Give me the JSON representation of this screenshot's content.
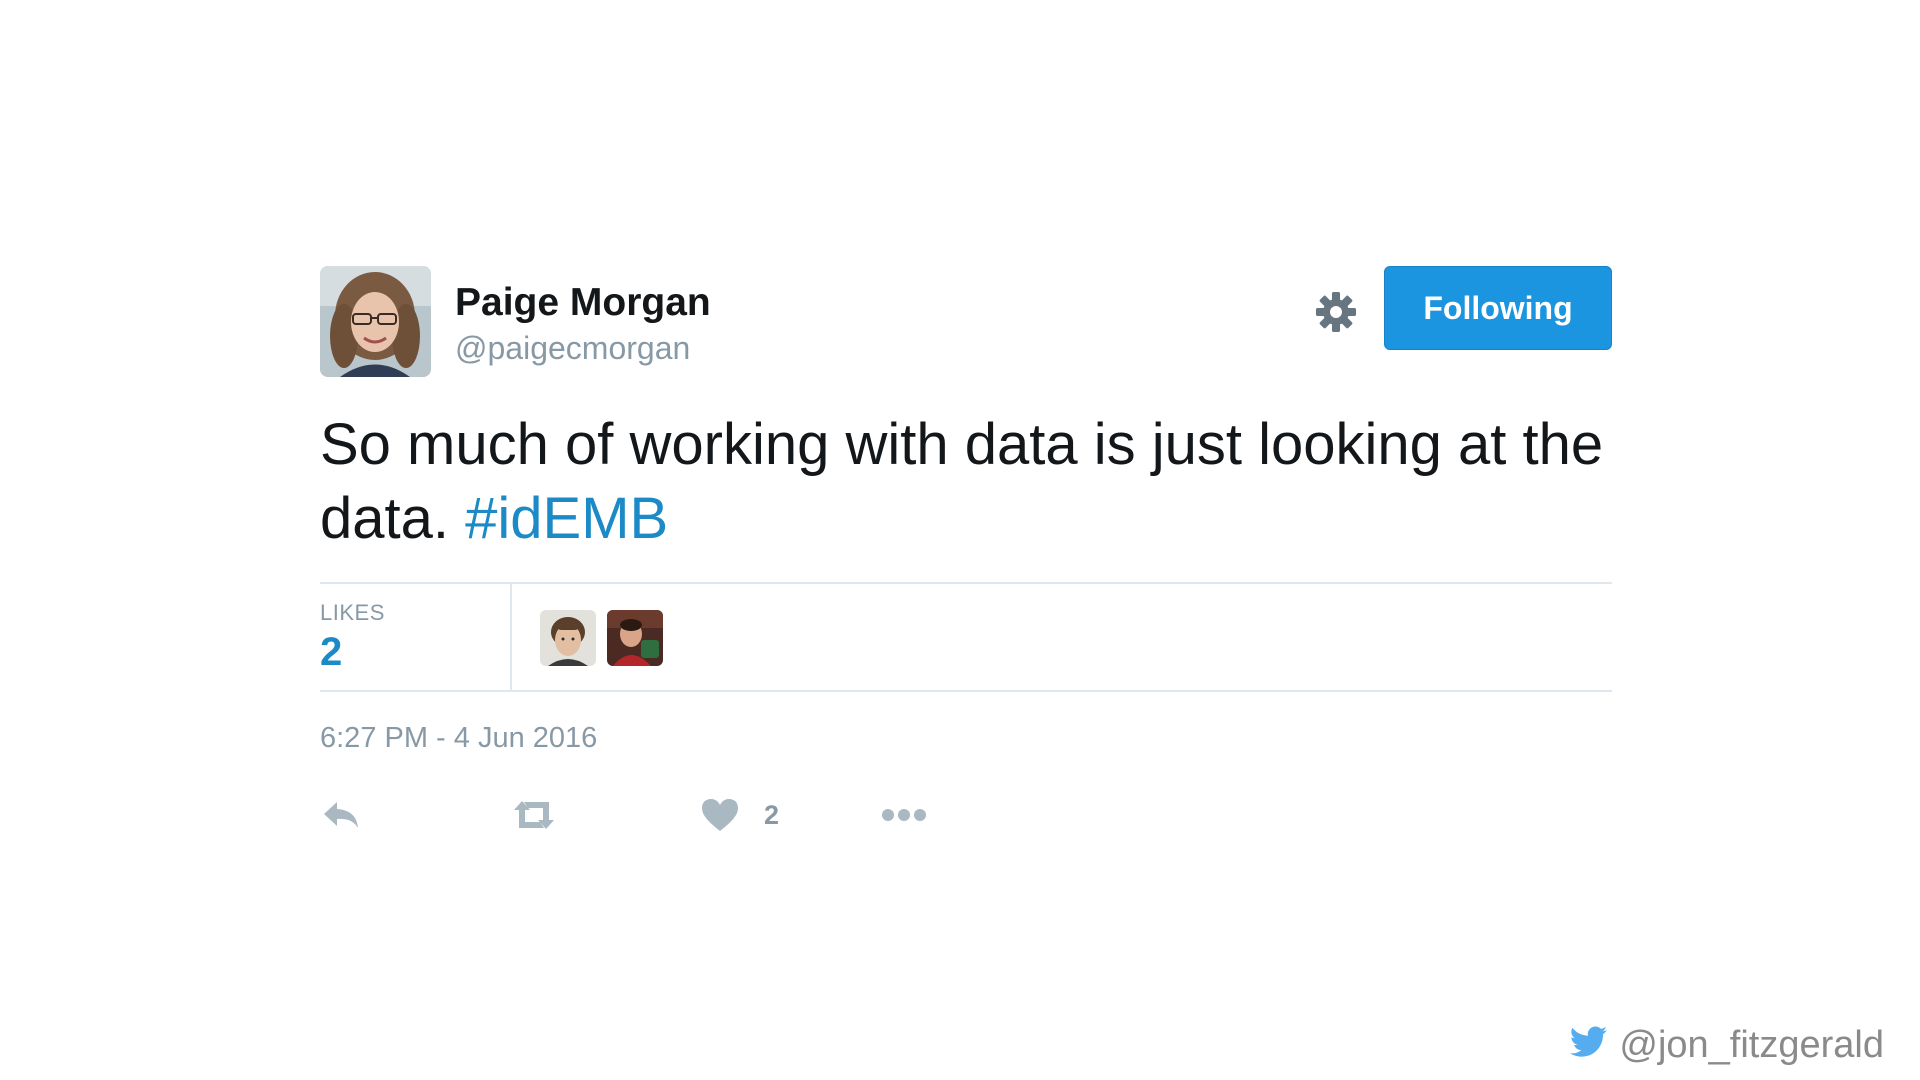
{
  "tweet": {
    "author_name": "Paige Morgan",
    "author_handle": "@paigecmorgan",
    "follow_button_label": "Following",
    "text_main": "So much of working with data is just looking at the data.",
    "hashtag": "#idEMB",
    "likes_label": "LIKES",
    "likes_count": "2",
    "timestamp": "6:27 PM - 4 Jun 2016",
    "action_like_count": "2"
  },
  "footer": {
    "credit_handle": "@jon_fitzgerald"
  },
  "icons": {
    "settings": "gear-icon",
    "reply": "reply-icon",
    "retweet": "retweet-icon",
    "like": "heart-icon",
    "more": "more-dots-icon",
    "brand": "twitter-bird-icon"
  },
  "colors": {
    "follow_button": "#1b95e0",
    "hashtag": "#1b8ac6",
    "muted_text": "#8899a6",
    "divider": "#e1e8ed",
    "twitter_blue": "#55acee"
  }
}
